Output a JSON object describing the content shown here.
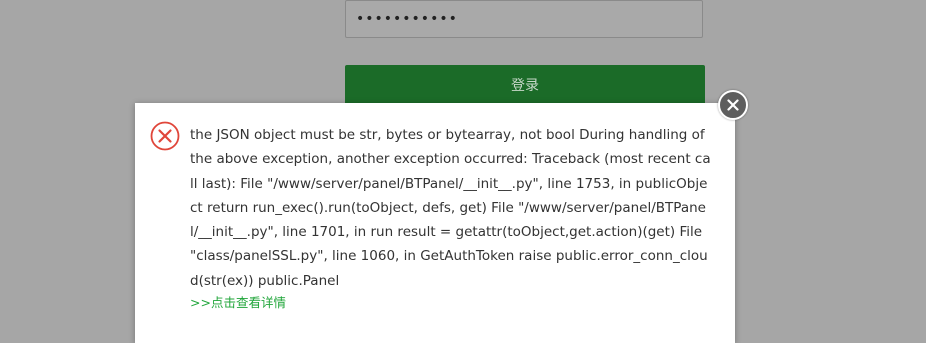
{
  "login_form": {
    "password_value": "•••••••••••",
    "login_button_label": "登录"
  },
  "error_dialog": {
    "message": "the JSON object must be str, bytes or bytearray, not bool During handling of the above exception, another exception occurred: Traceback (most recent call last): File \"/www/server/panel/BTPanel/__init__.py\", line 1753, in publicObject return run_exec().run(toObject, defs, get) File \"/www/server/panel/BTPanel/__init__.py\", line 1701, in run result = getattr(toObject,get.action)(get) File \"class/panelSSL.py\", line 1060, in GetAuthToken raise public.error_conn_cloud(str(ex)) public.Panel",
    "details_link": ">>点击查看详情",
    "icon": "error-circle-x-icon",
    "close_icon": "close-icon"
  },
  "colors": {
    "overlay_bg": "#a6a6a6",
    "login_button_bg": "#1b6b28",
    "error_red": "#e0463a",
    "link_green": "#20a53a",
    "close_button_bg": "#5e5e5e"
  }
}
